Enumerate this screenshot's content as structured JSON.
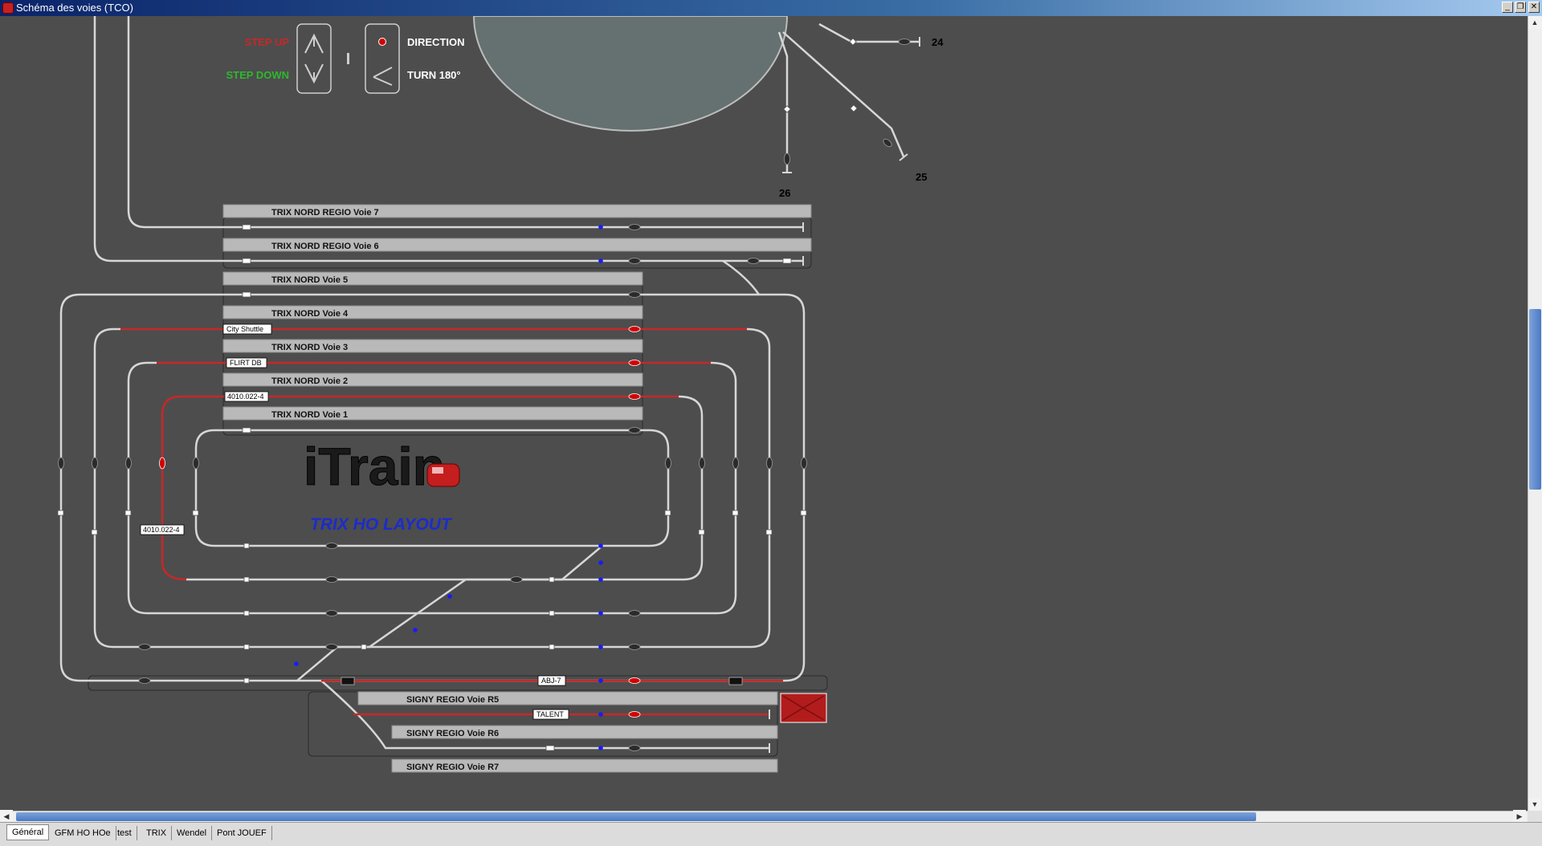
{
  "window": {
    "title": "Schéma des voies (TCO)"
  },
  "legend": {
    "step_up": "STEP UP",
    "step_down": "STEP DOWN",
    "direction": "DIRECTION",
    "turn": "TURN 180°"
  },
  "logo": {
    "text": "iTrain",
    "layout_label": "TRIX HO LAYOUT"
  },
  "platforms": [
    "TRIX NORD REGIO Voie 7",
    "TRIX NORD REGIO Voie 6",
    "TRIX NORD Voie 5",
    "TRIX NORD Voie 4",
    "TRIX NORD Voie 3",
    "TRIX NORD Voie 2",
    "TRIX NORD Voie 1",
    "SIGNY REGIO Voie R5",
    "SIGNY REGIO Voie R6",
    "SIGNY REGIO Voie R7"
  ],
  "trains": {
    "city_shuttle": "City Shuttle",
    "flirt": "FLIRT DB",
    "br4010_top": "4010.022-4",
    "br4010_left": "4010.022-4",
    "abj": "ABJ-7",
    "talent": "TALENT"
  },
  "turntable_tracks": {
    "t24": "24",
    "t25": "25",
    "t26": "26"
  },
  "tabs": [
    "Général",
    "GFM HO HOe",
    "test",
    "TRIX",
    "Wendel",
    "Pont JOUEF"
  ],
  "colors": {
    "track": "#d7d7d7",
    "occupied": "#c62828",
    "platform": "#b9b9b9",
    "background": "#4d4d4d",
    "logo_blue": "#1b2ccc"
  }
}
